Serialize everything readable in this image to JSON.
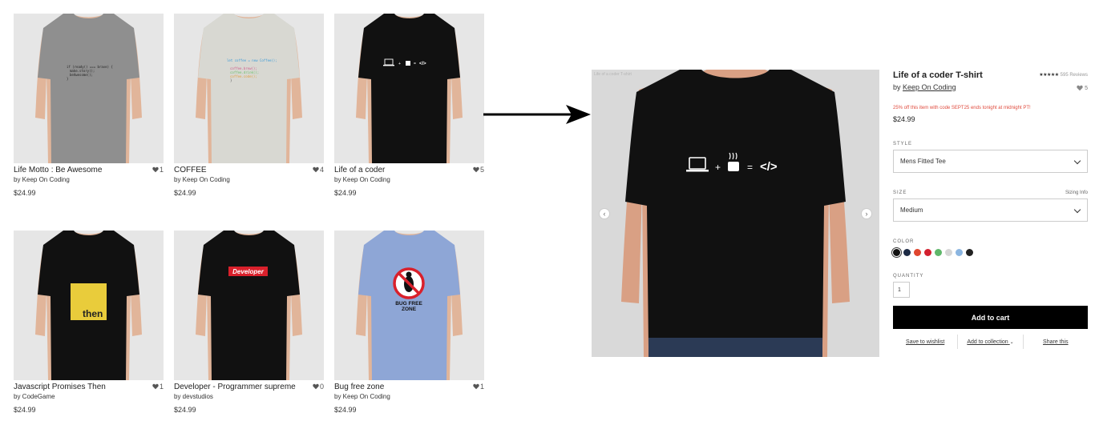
{
  "grid": {
    "products": [
      {
        "name": "Life Motto : Be Awesome",
        "likes": "1",
        "by": "by Keep On Coding",
        "price": "$24.99",
        "shirt_color": "#8f8f8f",
        "print": "code"
      },
      {
        "name": "COFFEE",
        "likes": "4",
        "by": "by Keep On Coding",
        "price": "$24.99",
        "shirt_color": "#d8d8d2",
        "print": "coffee-code"
      },
      {
        "name": "Life of a coder",
        "likes": "5",
        "by": "by Keep On Coding",
        "price": "$24.99",
        "shirt_color": "#111111",
        "print": "coder"
      },
      {
        "name": "Javascript Promises Then",
        "likes": "1",
        "by": "by CodeGame",
        "price": "$24.99",
        "shirt_color": "#111111",
        "print": "then"
      },
      {
        "name": "Developer - Programmer supreme",
        "likes": "0",
        "by": "by devstudios",
        "price": "$24.99",
        "shirt_color": "#111111",
        "print": "developer"
      },
      {
        "name": "Bug free zone",
        "likes": "1",
        "by": "by Keep On Coding",
        "price": "$24.99",
        "shirt_color": "#8ea6d6",
        "print": "bug"
      }
    ]
  },
  "prints": {
    "then_text": "then",
    "developer_text": "Developer",
    "bug_text_1": "BUG FREE",
    "bug_text_2": "ZONE",
    "coder_formula_plus": "+",
    "coder_formula_equals": "=",
    "coder_formula_tag": "</>"
  },
  "detail": {
    "caption": "Life of a coder T-shirt",
    "title": "Life of a coder T-shirt",
    "rating_stars": "★★★★★",
    "reviews": "595 Reviews",
    "by_prefix": "by",
    "by_link": "Keep On Coding",
    "likes": "5",
    "promo": "25% off this item with code SEPT25 ends tonight at midnight PT!",
    "price": "$24.99",
    "style_label": "STYLE",
    "style_value": "Mens Fitted Tee",
    "size_label": "SIZE",
    "sizing_info": "Sizing Info",
    "size_value": "Medium",
    "color_label": "COLOR",
    "colors": [
      "#111111",
      "#1c2a44",
      "#e0462e",
      "#d3202f",
      "#5fb76a",
      "#d6d6d6",
      "#8bb5e0",
      "#222222"
    ],
    "quantity_label": "QUANTITY",
    "quantity_value": "1",
    "add_to_cart": "Add to cart",
    "save_to_wishlist": "Save to wishlist",
    "add_to_collection": "Add to collection",
    "share": "Share this"
  }
}
